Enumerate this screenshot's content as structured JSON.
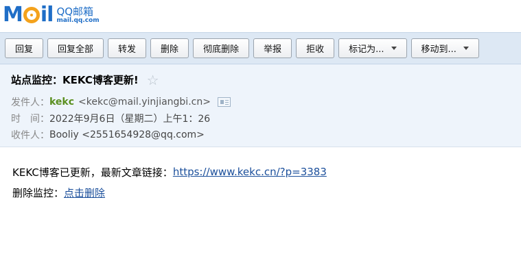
{
  "logo": {
    "mark_m": "M",
    "mark_il": "il",
    "cn": "QQ邮箱",
    "domain": "mail.qq.com"
  },
  "toolbar": {
    "buttons": [
      {
        "label": "回复"
      },
      {
        "label": "回复全部"
      },
      {
        "label": "转发"
      },
      {
        "label": "删除"
      },
      {
        "label": "彻底删除"
      },
      {
        "label": "举报"
      },
      {
        "label": "拒收"
      },
      {
        "label": "标记为..."
      },
      {
        "label": "移动到..."
      }
    ]
  },
  "header": {
    "subject": "站点监控：KEKC博客更新!",
    "star_icon": "star-outline-icon",
    "from_label": "发件人：",
    "from_name": "kekc",
    "from_addr": "<kekc@mail.yinjiangbi.cn>",
    "contact_card_icon": "contact-card-icon",
    "time_label": "时　间：",
    "time_value": "2022年9月6日（星期二）上午1：26",
    "to_label": "收件人：",
    "to_value": "Booliy <2551654928@qq.com>"
  },
  "body": {
    "line1_text": "KEKC博客已更新，最新文章链接：",
    "line1_link": "https://www.kekc.cn/?p=3383",
    "line2_text": "删除监控：",
    "line2_link": "点击删除"
  },
  "colors": {
    "brand_blue": "#1f6ec7",
    "brand_orange": "#f4a21c",
    "toolbar_bg": "#dde8f4",
    "header_bg": "#eef4fb",
    "sender_green": "#5a8f1f",
    "link_blue": "#1b4f9b"
  }
}
